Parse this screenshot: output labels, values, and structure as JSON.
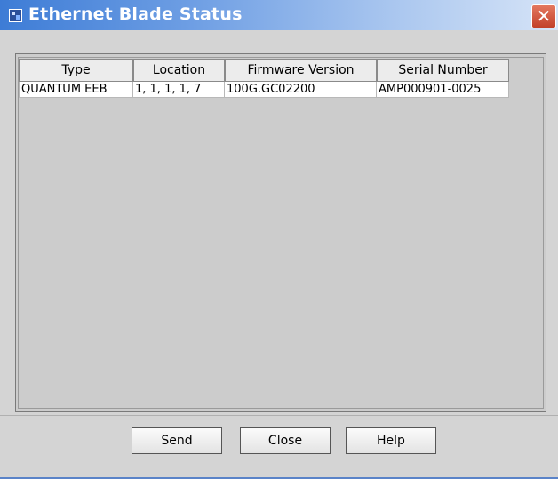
{
  "window": {
    "title": "Ethernet Blade Status",
    "close_glyph": "✕",
    "title_icon": "app-window-icon",
    "accent_color": "#3d7cd6"
  },
  "table": {
    "columns": [
      "Type",
      "Location",
      "Firmware Version",
      "Serial Number"
    ],
    "rows": [
      [
        "QUANTUM EEB",
        "1, 1, 1, 1, 7",
        "100G.GC02200",
        "AMP000901-0025"
      ]
    ]
  },
  "buttons": {
    "send": "Send",
    "close": "Close",
    "help": "Help"
  }
}
